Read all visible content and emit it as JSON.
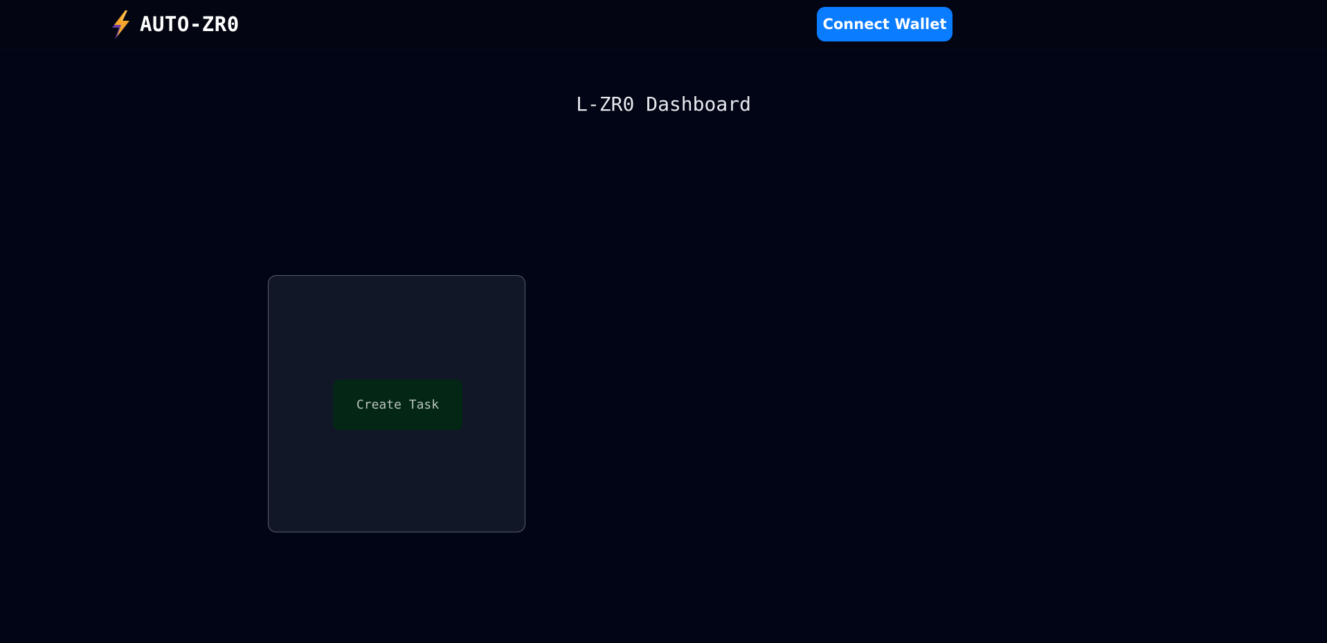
{
  "header": {
    "brand_icon": "lightning-bolt-icon",
    "brand_name": "AUTO-ZR0",
    "connect_wallet_label": "Connect Wallet",
    "accent_color": "#0a7cff"
  },
  "main": {
    "title": "L-ZR0 Dashboard",
    "task_card": {
      "create_task_label": "Create Task",
      "button_color": "#032615"
    }
  },
  "colors": {
    "background": "#020515",
    "card": "#111727",
    "card_border": "#5b5e6a"
  }
}
